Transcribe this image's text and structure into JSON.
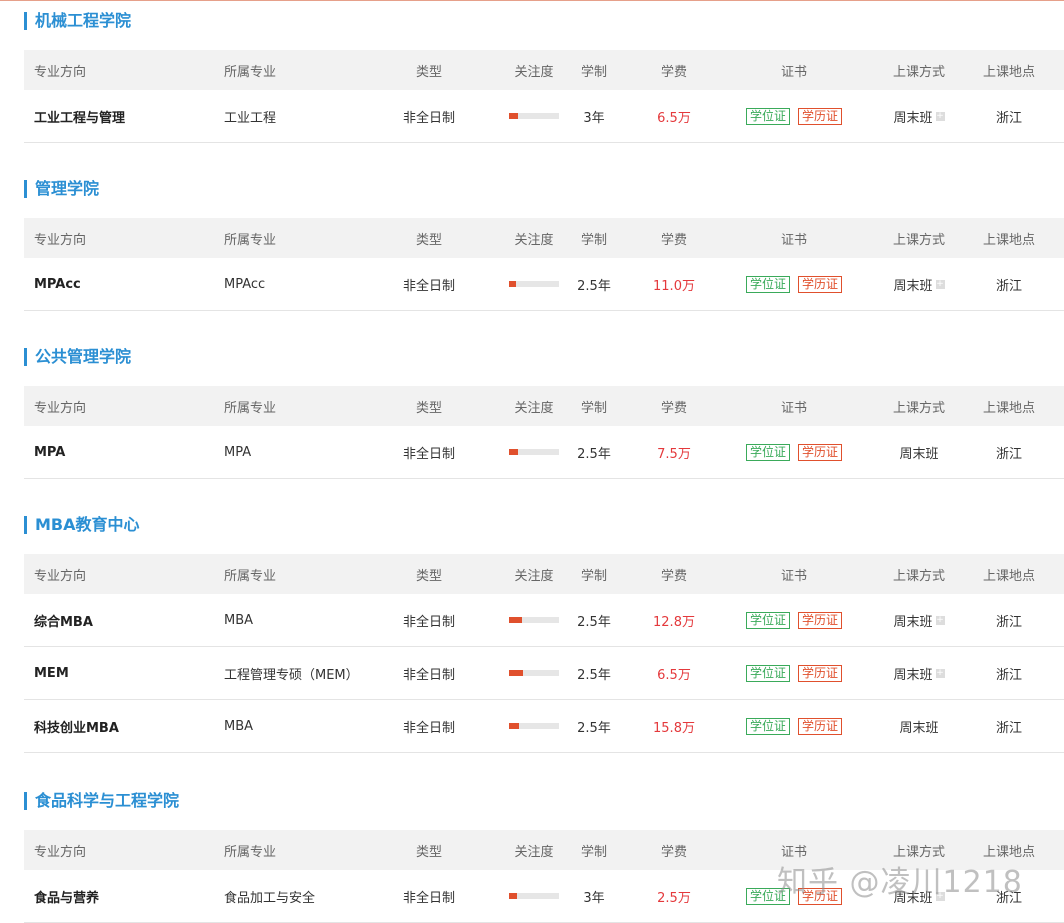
{
  "headers": [
    "专业方向",
    "所属专业",
    "类型",
    "关注度",
    "学制",
    "学费",
    "证书",
    "上课方式",
    "上课地点"
  ],
  "cert_labels": {
    "degree": "学位证",
    "diploma": "学历证"
  },
  "colors": {
    "accent": "#2b8fd3",
    "fee": "#e4393c",
    "bar": "#e0502d",
    "degree": "#3aaa5a",
    "diploma": "#e0502d"
  },
  "sections": [
    {
      "title": "机械工程学院",
      "rows": [
        {
          "direction": "工业工程与管理",
          "major": "工业工程",
          "type": "非全日制",
          "attention": 0.18,
          "duration": "3年",
          "fee": "6.5万",
          "mode": "周末班",
          "mode_more": true,
          "location": "浙江"
        }
      ]
    },
    {
      "title": "管理学院",
      "rows": [
        {
          "direction": "MPAcc",
          "major": "MPAcc",
          "type": "非全日制",
          "attention": 0.14,
          "duration": "2.5年",
          "fee": "11.0万",
          "mode": "周末班",
          "mode_more": true,
          "location": "浙江"
        }
      ]
    },
    {
      "title": "公共管理学院",
      "rows": [
        {
          "direction": "MPA",
          "major": "MPA",
          "type": "非全日制",
          "attention": 0.18,
          "duration": "2.5年",
          "fee": "7.5万",
          "mode": "周末班",
          "mode_more": false,
          "location": "浙江"
        }
      ]
    },
    {
      "title": "MBA教育中心",
      "rows": [
        {
          "direction": "综合MBA",
          "major": "MBA",
          "type": "非全日制",
          "attention": 0.26,
          "duration": "2.5年",
          "fee": "12.8万",
          "mode": "周末班",
          "mode_more": true,
          "location": "浙江"
        },
        {
          "direction": "MEM",
          "major": "工程管理专硕（MEM）",
          "type": "非全日制",
          "attention": 0.28,
          "duration": "2.5年",
          "fee": "6.5万",
          "mode": "周末班",
          "mode_more": true,
          "location": "浙江"
        },
        {
          "direction": "科技创业MBA",
          "major": "MBA",
          "type": "非全日制",
          "attention": 0.2,
          "duration": "2.5年",
          "fee": "15.8万",
          "mode": "周末班",
          "mode_more": false,
          "location": "浙江"
        }
      ]
    },
    {
      "title": "食品科学与工程学院",
      "rows": [
        {
          "direction": "食品与营养",
          "major": "食品加工与安全",
          "type": "非全日制",
          "attention": 0.16,
          "duration": "3年",
          "fee": "2.5万",
          "mode": "周末班",
          "mode_more": true,
          "location": "浙江"
        }
      ]
    }
  ],
  "watermark": "知乎 @凌川1218"
}
